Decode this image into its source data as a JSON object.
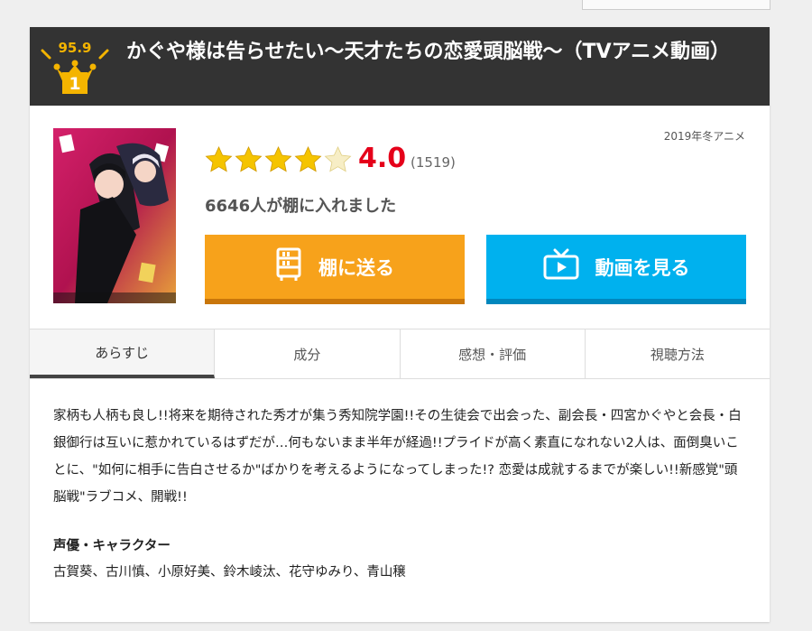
{
  "header": {
    "score": "95.9",
    "rank": "1",
    "title": "かぐや様は告らせたい〜天才たちの恋愛頭脳戦〜（TVアニメ動画）"
  },
  "season": "2019年冬アニメ",
  "rating": {
    "stars": 4.0,
    "value": "4.0",
    "count": "(1519)"
  },
  "shelf_count": "6646人が棚に入れました",
  "buttons": {
    "shelf_label": "棚に送る",
    "video_label": "動画を見る",
    "shelf_icon": "shelf-icon",
    "video_icon": "tv-icon"
  },
  "tabs": [
    {
      "label": "あらすじ",
      "active": true
    },
    {
      "label": "成分"
    },
    {
      "label": "感想・評価"
    },
    {
      "label": "視聴方法"
    }
  ],
  "synopsis": "家柄も人柄も良し!!将来を期待された秀才が集う秀知院学園!!その生徒会で出会った、副会長・四宮かぐやと会長・白銀御行は互いに惹かれているはずだが…何もないまま半年が経過!!プライドが高く素直になれない2人は、面倒臭いことに、\"如何に相手に告白させるか\"ばかりを考えるようになってしまった!? 恋愛は成就するまでが楽しい!!新感覚\"頭脳戦\"ラブコメ、開戦!!",
  "cast": {
    "heading": "声優・キャラクター",
    "list": "古賀葵、古川慎、小原好美、鈴木崚汰、花守ゆみり、青山穣"
  },
  "colors": {
    "header_bg": "#333333",
    "gold": "#f4b400",
    "rating_red": "#e5001a",
    "shelf_orange": "#f7a21b",
    "video_blue": "#00b1ee"
  }
}
